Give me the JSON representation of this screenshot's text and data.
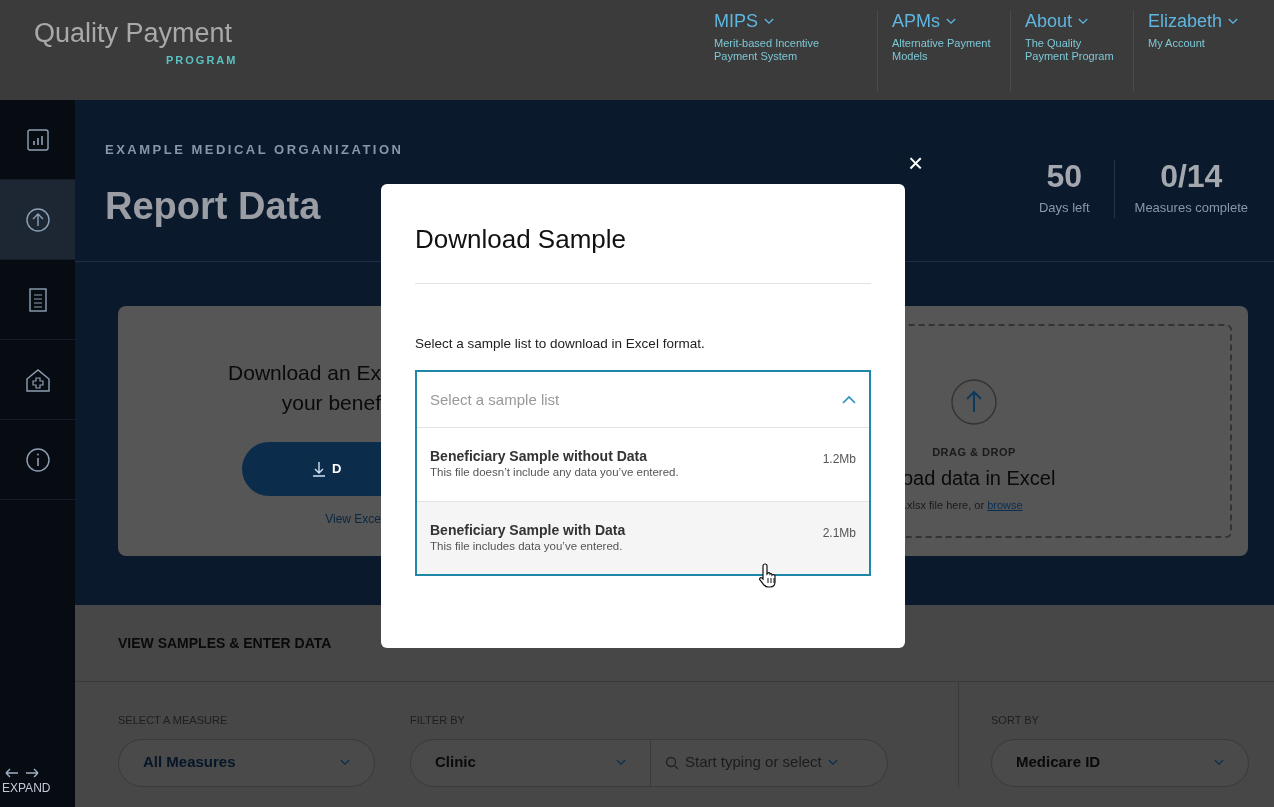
{
  "header": {
    "logo_top": "Quality Payment",
    "logo_bottom": "PROGRAM",
    "nav": [
      {
        "label": "MIPS",
        "sublabel": "Merit-based Incentive Payment System"
      },
      {
        "label": "APMs",
        "sublabel": "Alternative Payment Models"
      },
      {
        "label": "About",
        "sublabel": "The Quality Payment Program"
      },
      {
        "label": "Elizabeth",
        "sublabel": "My Account"
      }
    ]
  },
  "sidebar": {
    "items": [
      {
        "kind": "chart",
        "selected": false
      },
      {
        "kind": "upload",
        "selected": true
      },
      {
        "kind": "document",
        "selected": false
      },
      {
        "kind": "clinic",
        "selected": false
      },
      {
        "kind": "info",
        "selected": false
      }
    ],
    "expand_label": "EXPAND"
  },
  "banner": {
    "organization": "EXAMPLE MEDICAL ORGANIZATION",
    "title": "Report Data",
    "stats": [
      {
        "value": "50",
        "label": "Days left"
      },
      {
        "value": "0/14",
        "label": "Measures complete"
      }
    ],
    "download_card": {
      "lines": [
        "Download an Ex",
        "your benef"
      ],
      "button": "D",
      "link": "View Exce"
    },
    "dropzone": {
      "caption": "DRAG & DROP",
      "heading": "oad data in Excel",
      "hint": ".xlsx file here, or",
      "link": "browse"
    }
  },
  "lower": {
    "title": "VIEW SAMPLES & ENTER DATA",
    "measure": {
      "label": "SELECT A MEASURE",
      "value": "All Measures"
    },
    "filter": {
      "label": "FILTER BY",
      "value": "Clinic",
      "search_placeholder": "Start typing or select"
    },
    "sort": {
      "label": "SORT BY",
      "value": "Medicare ID"
    }
  },
  "modal": {
    "close": "×",
    "title": "Download Sample",
    "instruction": "Select a sample list to download in Excel format.",
    "dropdown": {
      "placeholder": "Select a sample list",
      "expanded": true,
      "options": [
        {
          "title": "Beneficiary Sample without Data",
          "description": "This file doesn’t include any data you’ve entered.",
          "size": "1.2Mb",
          "highlighted": false
        },
        {
          "title": "Beneficiary Sample with Data",
          "description": "This file includes data you’ve entered.",
          "size": "2.1Mb",
          "highlighted": true
        }
      ]
    }
  }
}
